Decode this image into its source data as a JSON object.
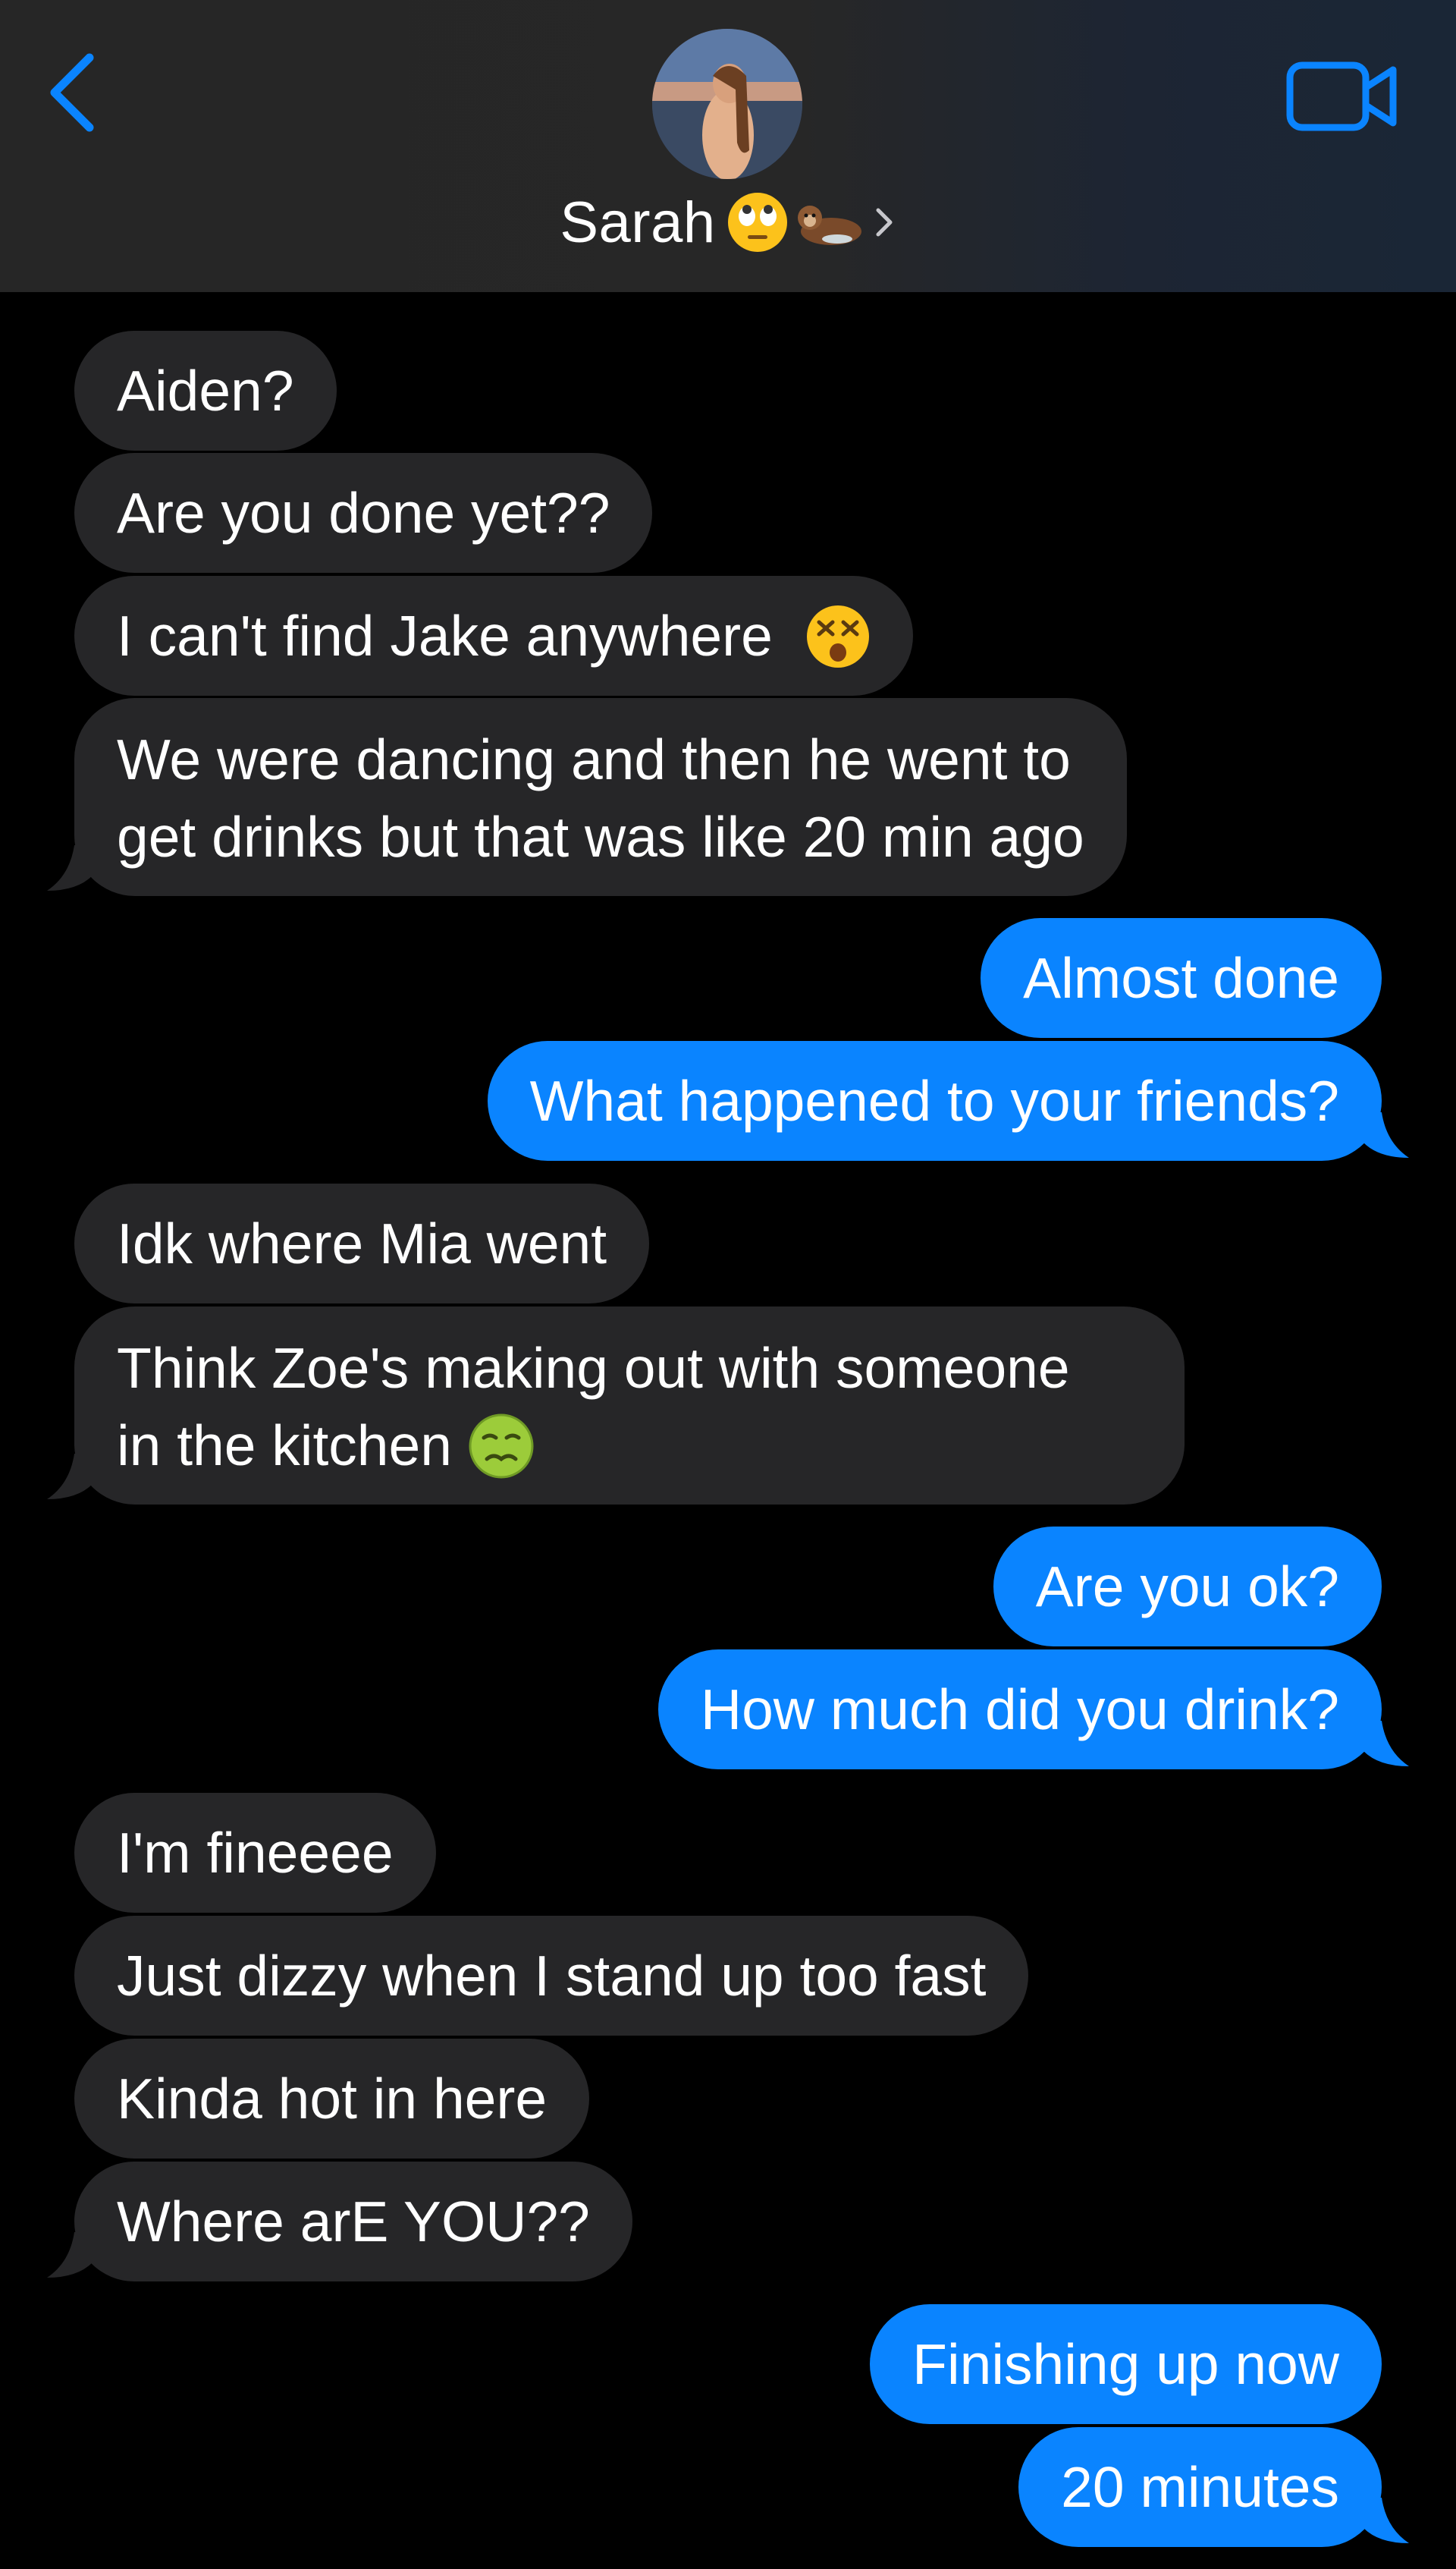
{
  "header": {
    "contact_name": "Sarah",
    "back_icon": "chevron-left-icon",
    "video_icon": "video-camera-icon",
    "name_emojis": [
      "eye-roll-emoji",
      "otter-emoji"
    ],
    "accent_color": "#0a84ff"
  },
  "colors": {
    "incoming_bubble": "#262628",
    "outgoing_bubble": "#0a84ff",
    "background": "#000000"
  },
  "messages": [
    {
      "from": "them",
      "text": "Aiden?"
    },
    {
      "from": "them",
      "text": "Are you done yet??"
    },
    {
      "from": "them",
      "text": "I can't find Jake anywhere",
      "emoji": "dizzy-face-emoji"
    },
    {
      "from": "them",
      "line1": "We were dancing and then he went to",
      "line2": "get drinks but that was like 20 min ago"
    },
    {
      "from": "me",
      "text": "Almost done"
    },
    {
      "from": "me",
      "text": "What happened to your friends?"
    },
    {
      "from": "them",
      "text": "Idk where Mia went"
    },
    {
      "from": "them",
      "line1": "Think Zoe's making out with someone",
      "line2": "in the kitchen",
      "emoji": "nauseated-face-emoji"
    },
    {
      "from": "me",
      "text": "Are you ok?"
    },
    {
      "from": "me",
      "text": "How much did you drink?"
    },
    {
      "from": "them",
      "text": "I'm fineeee"
    },
    {
      "from": "them",
      "text": "Just dizzy when I stand up too fast"
    },
    {
      "from": "them",
      "text": "Kinda hot in here"
    },
    {
      "from": "them",
      "text": "Where arE YOU??"
    },
    {
      "from": "me",
      "text": "Finishing up now"
    },
    {
      "from": "me",
      "text": "20 minutes"
    }
  ]
}
